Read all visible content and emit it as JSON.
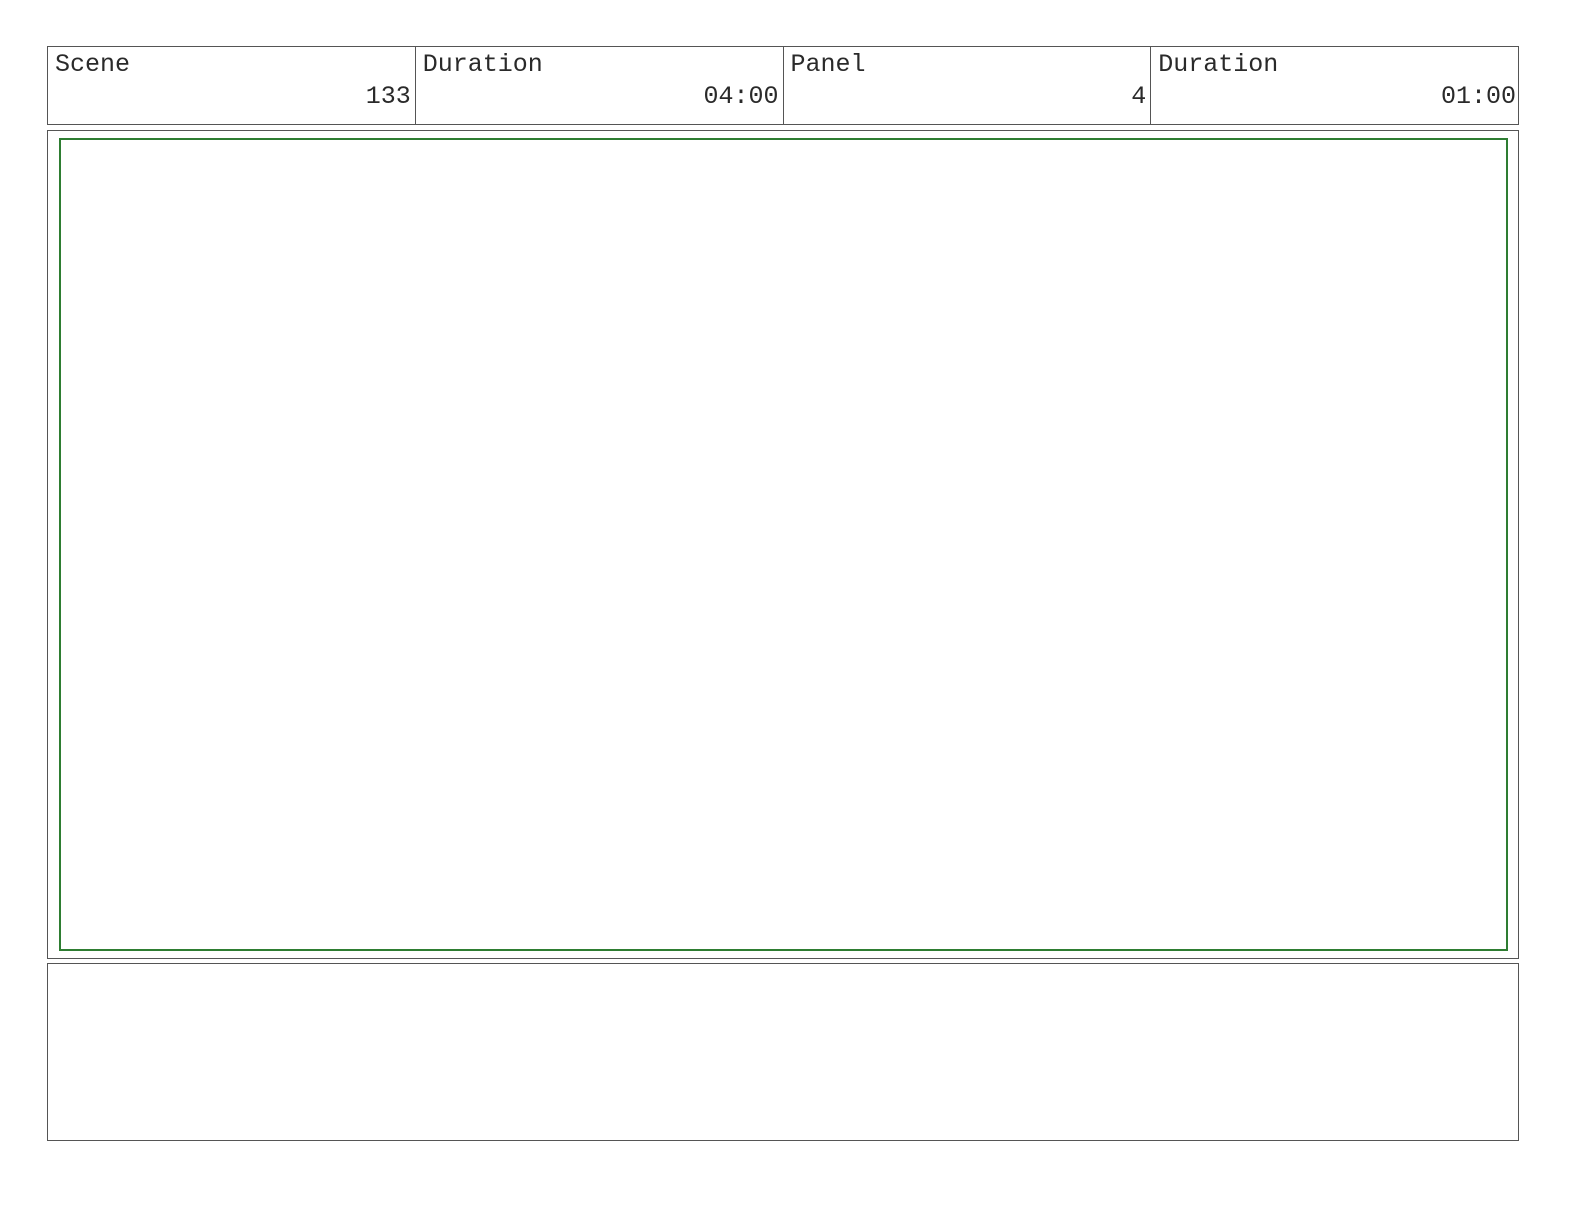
{
  "header": {
    "cells": [
      {
        "label": "Scene",
        "value": "133"
      },
      {
        "label": "Duration",
        "value": "04:00"
      },
      {
        "label": "Panel",
        "value": "4"
      },
      {
        "label": "Duration",
        "value": "01:00"
      }
    ]
  },
  "panel": {
    "frame_color": "#2e7d32"
  },
  "notes": {
    "text": ""
  }
}
